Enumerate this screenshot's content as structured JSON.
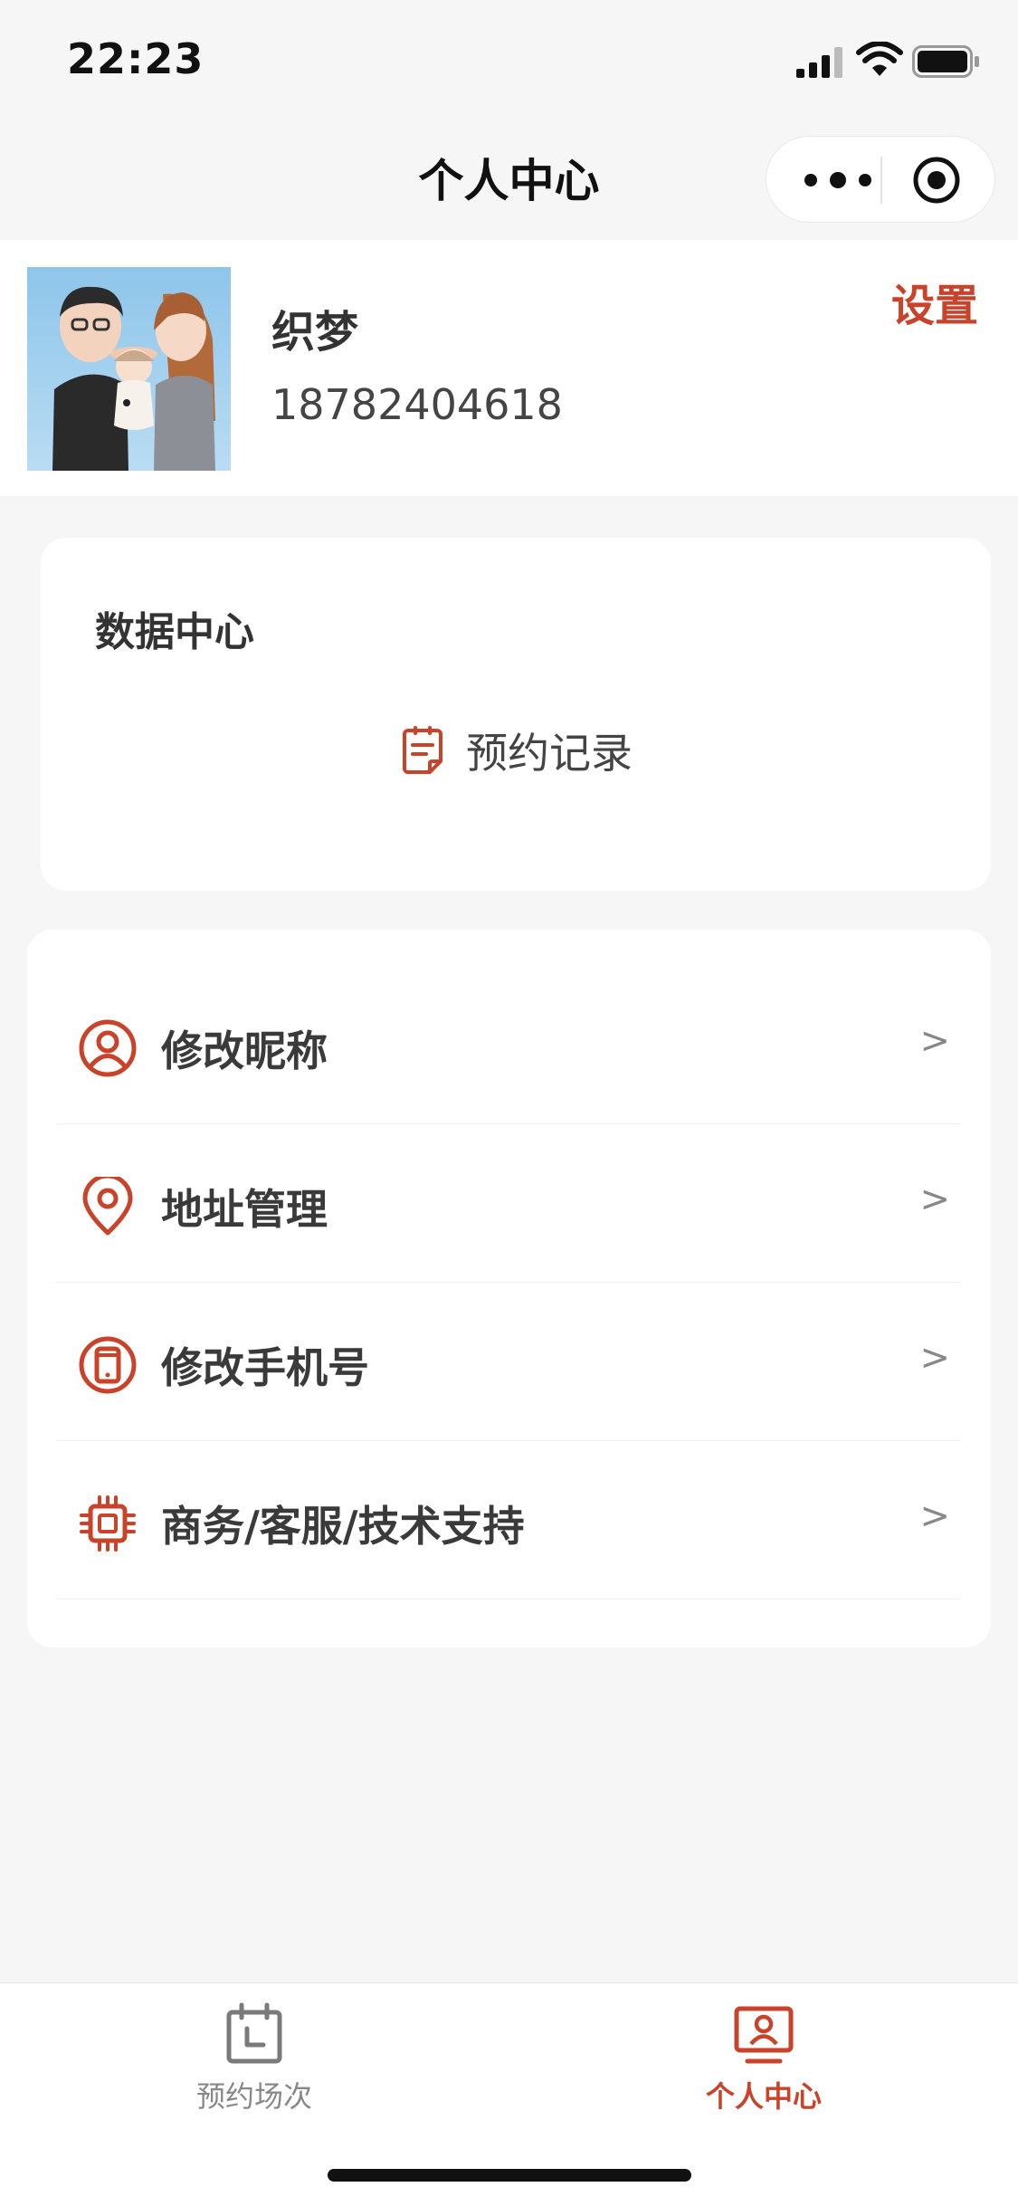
{
  "status_bar": {
    "time": "22:23"
  },
  "nav": {
    "title": "个人中心"
  },
  "profile": {
    "name": "织梦",
    "phone": "18782404618",
    "settings_label": "设置"
  },
  "data_center": {
    "title": "数据中心",
    "record_label": "预约记录"
  },
  "menu": {
    "items": [
      {
        "label": "修改昵称",
        "icon": "user-circle-icon",
        "chevron": ">"
      },
      {
        "label": "地址管理",
        "icon": "location-pin-icon",
        "chevron": ">"
      },
      {
        "label": "修改手机号",
        "icon": "phone-icon",
        "chevron": ">"
      },
      {
        "label": "商务/客服/技术支持",
        "icon": "chip-icon",
        "chevron": ">"
      }
    ]
  },
  "tab_bar": {
    "tabs": [
      {
        "label": "预约场次",
        "icon": "calendar-icon",
        "active": false
      },
      {
        "label": "个人中心",
        "icon": "profile-monitor-icon",
        "active": true
      }
    ]
  },
  "colors": {
    "accent": "#c9432a",
    "background": "#f6f6f6",
    "card": "#ffffff",
    "text": "#333333",
    "muted": "#888888"
  }
}
